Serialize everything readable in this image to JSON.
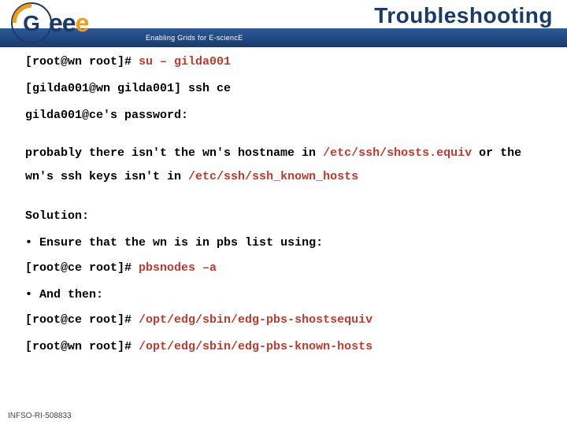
{
  "header": {
    "title": "Troubleshooting",
    "subtitle": "Enabling Grids for E-sciencE"
  },
  "logo": {
    "t1": "e",
    "t2": "e",
    "t3": "e"
  },
  "body": {
    "line1a": "[root@wn root]# ",
    "line1b": "su – gilda001",
    "line2": "[gilda001@wn gilda001] ssh ce",
    "line3": "gilda001@ce's password:",
    "line4a": "probably there isn't the wn's hostname in ",
    "line4b": "/etc/ssh/shosts.equiv",
    "line4c": " or the wn's ssh keys isn't in ",
    "line4d": "/etc/ssh/ssh_known_hosts",
    "solution": "Solution:",
    "b1": "Ensure that the wn is in pbs list using:",
    "cmd1a": "[root@ce root]# ",
    "cmd1b": "pbsnodes –a",
    "b2": "And then:",
    "cmd2a": "[root@ce root]# ",
    "cmd2b": "/opt/edg/sbin/edg-pbs-shostsequiv",
    "cmd3a": "[root@wn root]# ",
    "cmd3b": "/opt/edg/sbin/edg-pbs-known-hosts"
  },
  "footer": "INFSO-RI-508833"
}
